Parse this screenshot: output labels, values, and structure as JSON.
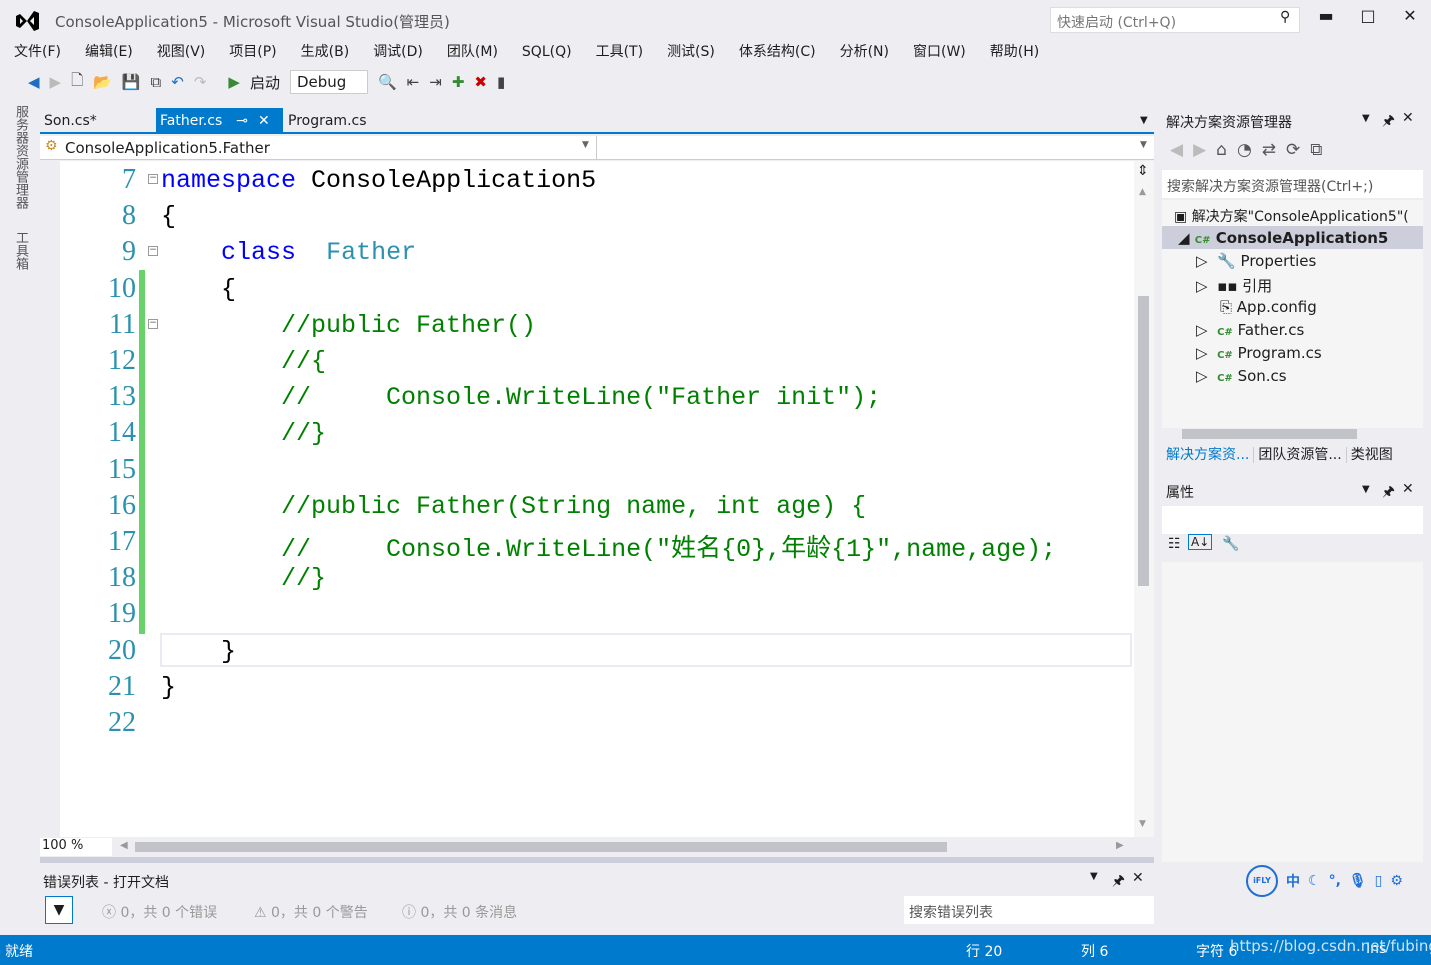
{
  "window": {
    "title": "ConsoleApplication5 - Microsoft Visual Studio(管理员)",
    "quick_launch": "快速启动 (Ctrl+Q)",
    "minimize": "▬",
    "maximize": "□",
    "close": "✕"
  },
  "menu": [
    "文件(F)",
    "编辑(E)",
    "视图(V)",
    "项目(P)",
    "生成(B)",
    "调试(D)",
    "团队(M)",
    "SQL(Q)",
    "工具(T)",
    "测试(S)",
    "体系结构(C)",
    "分析(N)",
    "窗口(W)",
    "帮助(H)"
  ],
  "toolbar": {
    "start": "启动",
    "config": "Debug"
  },
  "side_tabs": [
    "服务器资源管理器",
    "工具箱"
  ],
  "editor": {
    "tabs": [
      "Son.cs*",
      "Father.cs",
      "Program.cs"
    ],
    "active_tab": "Father.cs",
    "nav_class": "ConsoleApplication5.Father",
    "line_numbers": [
      "7",
      "8",
      "9",
      "10",
      "11",
      "12",
      "13",
      "14",
      "15",
      "16",
      "17",
      "18",
      "19",
      "20",
      "21",
      "22"
    ],
    "lines": [
      [
        [
          "kw",
          "namespace"
        ],
        [
          "",
          "ConsoleApplication5"
        ]
      ],
      [
        [
          "",
          "{"
        ]
      ],
      [
        [
          "",
          "    "
        ],
        [
          "kw",
          "class"
        ],
        [
          "",
          ""
        ],
        [
          "ty",
          "Father"
        ]
      ],
      [
        [
          "",
          "    {"
        ]
      ],
      [
        [
          "cm",
          "        //public Father()"
        ]
      ],
      [
        [
          "cm",
          "        //{"
        ]
      ],
      [
        [
          "cm",
          "        //     Console.WriteLine(\"Father init\");"
        ]
      ],
      [
        [
          "cm",
          "        //}"
        ]
      ],
      [
        [
          "",
          ""
        ]
      ],
      [
        [
          "cm",
          "        //public Father(String name, int age) {"
        ]
      ],
      [
        [
          "cm",
          "        //     Console.WriteLine(\"姓名{0},年龄{1}\",name,age);"
        ]
      ],
      [
        [
          "cm",
          "        //}"
        ]
      ],
      [
        [
          "",
          ""
        ]
      ],
      [
        [
          "",
          "    }"
        ]
      ],
      [
        [
          "",
          "}"
        ]
      ],
      [
        [
          "",
          ""
        ]
      ]
    ],
    "zoom": "100 %"
  },
  "solution_explorer": {
    "title": "解决方案资源管理器",
    "search_placeholder": "搜索解决方案资源管理器(Ctrl+;)",
    "solution": "解决方案\"ConsoleApplication5\"(",
    "project": "ConsoleApplication5",
    "items": [
      "Properties",
      "引用",
      "App.config",
      "Father.cs",
      "Program.cs",
      "Son.cs"
    ],
    "bottom_tabs": [
      "解决方案资...",
      "团队资源管...",
      "类视图"
    ]
  },
  "properties": {
    "title": "属性"
  },
  "error_list": {
    "title": "错误列表 - 打开文档",
    "errors": "0，共 0 个错误",
    "warnings": "0，共 0 个警告",
    "messages": "0，共 0 条消息",
    "search_placeholder": "搜索错误列表"
  },
  "ime": {
    "logo": "iFLY",
    "mode": "中"
  },
  "status": {
    "ready": "就绪",
    "row": "行 20",
    "col": "列 6",
    "char": "字符 6",
    "ins": "Ins",
    "watermark": "https://blog.csdn.net/fubing"
  }
}
